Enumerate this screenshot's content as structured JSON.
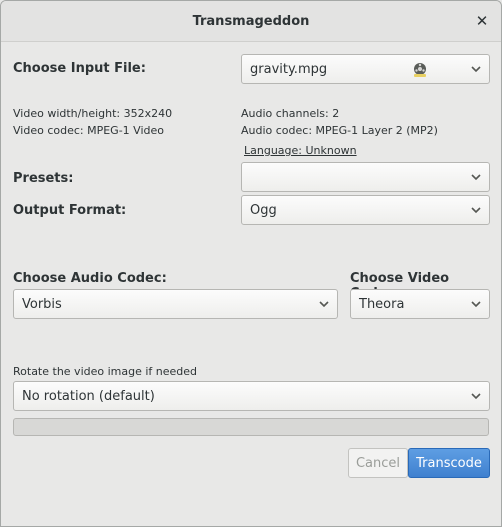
{
  "window": {
    "title": "Transmageddon"
  },
  "input_file": {
    "label": "Choose Input File:",
    "value": "gravity.mpg",
    "icon": "film-reel-icon"
  },
  "video_info": {
    "size": "Video width/height: 352x240",
    "codec": "Video codec: MPEG-1 Video"
  },
  "audio_info": {
    "channels": "Audio channels: 2",
    "codec": "Audio codec: MPEG-1 Layer 2 (MP2)",
    "language": "Language: Unknown"
  },
  "presets": {
    "label": "Presets:",
    "value": ""
  },
  "output_format": {
    "label": "Output Format:",
    "value": "Ogg"
  },
  "audio_codec": {
    "label": "Choose Audio Codec:",
    "value": "Vorbis"
  },
  "video_codec": {
    "label": "Choose Video Codec:",
    "value": "Theora"
  },
  "rotation": {
    "label": "Rotate the video image if needed",
    "value": "No rotation (default)"
  },
  "progress": {
    "fraction": 0
  },
  "buttons": {
    "cancel": "Cancel",
    "transcode": "Transcode"
  },
  "colors": {
    "accent": "#4a90d9",
    "background": "#e8e8e7"
  }
}
